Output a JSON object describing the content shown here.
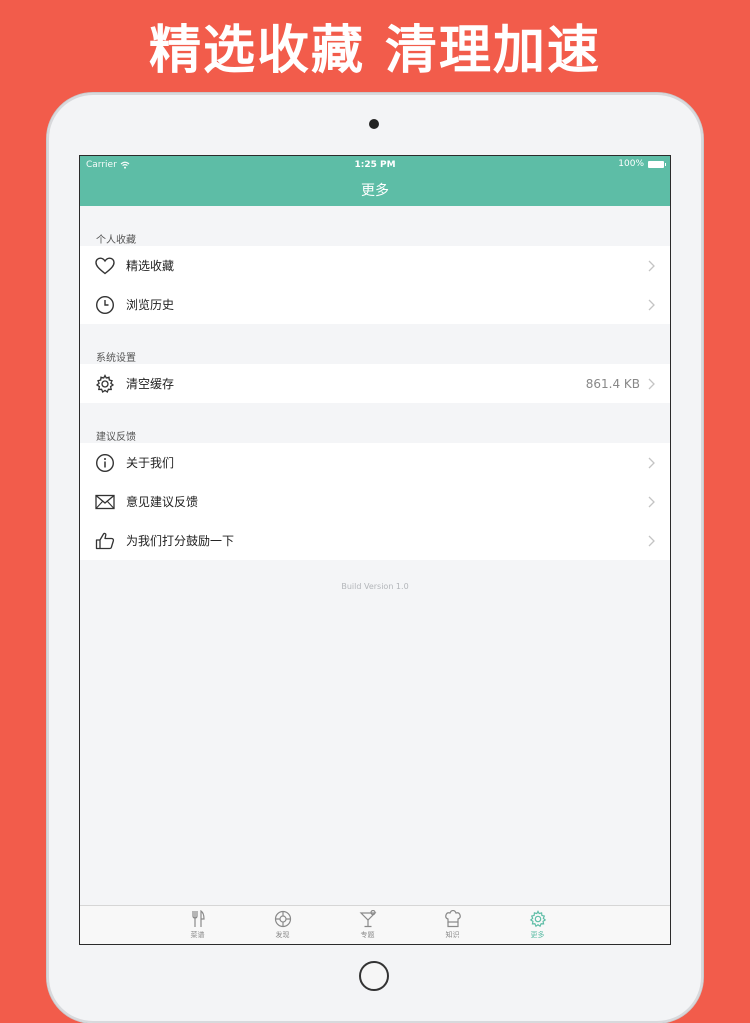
{
  "promo": {
    "title": "精选收藏 清理加速"
  },
  "status_bar": {
    "carrier": "Carrier",
    "time": "1:25 PM",
    "battery": "100%"
  },
  "nav": {
    "title": "更多"
  },
  "sections": [
    {
      "title": "个人收藏",
      "items": [
        {
          "icon": "heart-icon",
          "label": "精选收藏"
        },
        {
          "icon": "clock-icon",
          "label": "浏览历史"
        }
      ]
    },
    {
      "title": "系统设置",
      "items": [
        {
          "icon": "gear-icon",
          "label": "清空缓存",
          "value": "861.4 KB"
        }
      ]
    },
    {
      "title": "建议反馈",
      "items": [
        {
          "icon": "info-icon",
          "label": "关于我们"
        },
        {
          "icon": "envelope-icon",
          "label": "意见建议反馈"
        },
        {
          "icon": "thumbs-up-icon",
          "label": "为我们打分鼓励一下"
        }
      ]
    }
  ],
  "build": "Build Version 1.0",
  "tabbar": {
    "tabs": [
      {
        "label": "菜谱",
        "icon": "fork-knife-icon"
      },
      {
        "label": "发现",
        "icon": "compass-icon"
      },
      {
        "label": "专题",
        "icon": "cocktail-icon"
      },
      {
        "label": "知识",
        "icon": "chef-hat-icon"
      },
      {
        "label": "更多",
        "icon": "gear-icon",
        "active": true
      }
    ]
  },
  "colors": {
    "background": "#F25C4B",
    "header": "#5DBDA6",
    "active_tab": "#5DBDA6"
  }
}
